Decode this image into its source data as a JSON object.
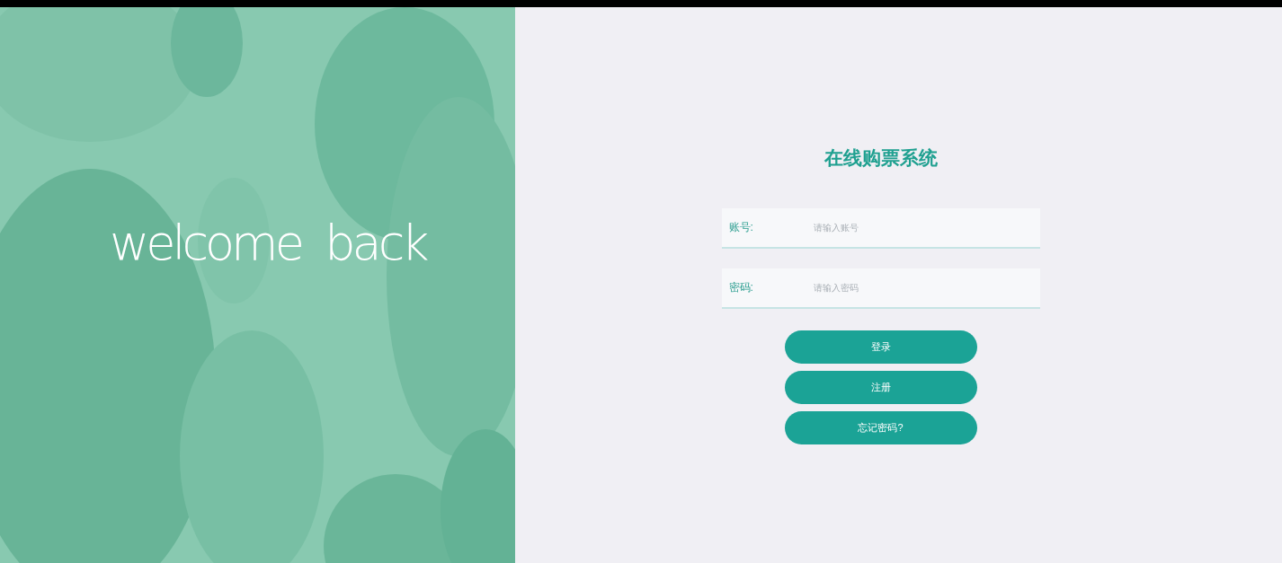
{
  "hero": {
    "text": "welcome  back"
  },
  "title": "在线购票系统",
  "fields": [
    {
      "label": "账号:",
      "placeholder": "请输入账号"
    },
    {
      "label": "密码:",
      "placeholder": "请输入密码"
    }
  ],
  "buttons": [
    {
      "label": "登录"
    },
    {
      "label": "注册"
    },
    {
      "label": "忘记密码?"
    }
  ]
}
